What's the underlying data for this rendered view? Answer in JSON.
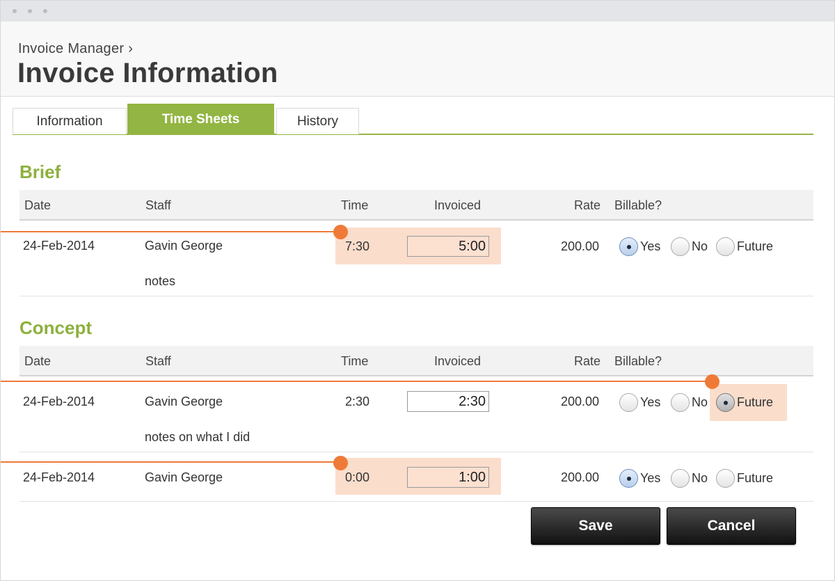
{
  "header": {
    "breadcrumb": "Invoice Manager ›",
    "title": "Invoice Information"
  },
  "tabs": [
    {
      "label": "Information",
      "active": false
    },
    {
      "label": "Time Sheets",
      "active": true
    },
    {
      "label": "History",
      "active": false
    }
  ],
  "columns": {
    "date": "Date",
    "staff": "Staff",
    "time": "Time",
    "invoiced": "Invoiced",
    "rate": "Rate",
    "billable": "Billable?"
  },
  "billable_options": [
    "Yes",
    "No",
    "Future"
  ],
  "sections": [
    {
      "title": "Brief",
      "rows": [
        {
          "date": "24-Feb-2014",
          "staff": "Gavin George",
          "notes": "notes",
          "time": "7:30",
          "invoiced": "5:00",
          "rate": "200.00",
          "billable": "Yes"
        }
      ]
    },
    {
      "title": "Concept",
      "rows": [
        {
          "date": "24-Feb-2014",
          "staff": "Gavin George",
          "notes": "notes on what I did",
          "time": "2:30",
          "invoiced": "2:30",
          "rate": "200.00",
          "billable": "Future"
        },
        {
          "date": "24-Feb-2014",
          "staff": "Gavin George",
          "notes": "",
          "time": "0:00",
          "invoiced": "1:00",
          "rate": "200.00",
          "billable": "Yes"
        }
      ]
    }
  ],
  "actions": {
    "save_label": "Save",
    "cancel_label": "Cancel"
  },
  "colors": {
    "accent": "#93b543",
    "highlight": "#fbddcc",
    "callout": "#ef7a37"
  }
}
